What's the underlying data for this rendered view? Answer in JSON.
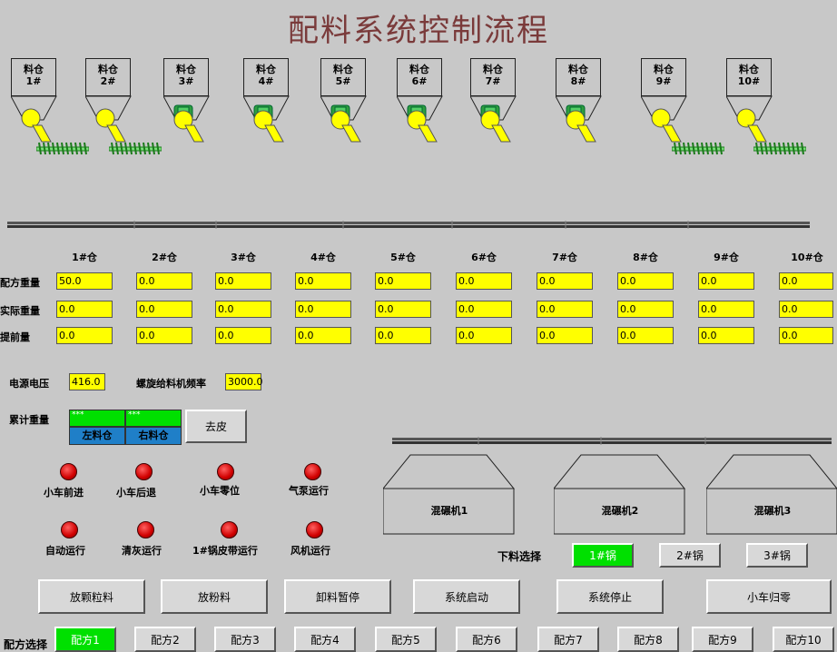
{
  "title": "配料系统控制流程",
  "hoppers": [
    {
      "label": "料仓",
      "num": "1#",
      "running": false,
      "screw": true
    },
    {
      "label": "料仓",
      "num": "2#",
      "running": false,
      "screw": true
    },
    {
      "label": "料仓",
      "num": "3#",
      "running": true,
      "screw": false
    },
    {
      "label": "料仓",
      "num": "4#",
      "running": true,
      "screw": false
    },
    {
      "label": "料仓",
      "num": "5#",
      "running": true,
      "screw": false
    },
    {
      "label": "料仓",
      "num": "6#",
      "running": true,
      "screw": false
    },
    {
      "label": "料仓",
      "num": "7#",
      "running": true,
      "screw": false
    },
    {
      "label": "料仓",
      "num": "8#",
      "running": true,
      "screw": false
    },
    {
      "label": "料仓",
      "num": "9#",
      "running": false,
      "screw": true
    },
    {
      "label": "料仓",
      "num": "10#",
      "running": false,
      "screw": true
    }
  ],
  "table": {
    "columns": [
      "1#仓",
      "2#仓",
      "3#仓",
      "4#仓",
      "5#仓",
      "6#仓",
      "7#仓",
      "8#仓",
      "9#仓",
      "10#仓"
    ],
    "rows": [
      {
        "label": "配方重量",
        "values": [
          "50.0",
          "0.0",
          "0.0",
          "0.0",
          "0.0",
          "0.0",
          "0.0",
          "0.0",
          "0.0",
          "0.0"
        ]
      },
      {
        "label": "实际重量",
        "values": [
          "0.0",
          "0.0",
          "0.0",
          "0.0",
          "0.0",
          "0.0",
          "0.0",
          "0.0",
          "0.0",
          "0.0"
        ]
      },
      {
        "label": "提前量",
        "values": [
          "0.0",
          "0.0",
          "0.0",
          "0.0",
          "0.0",
          "0.0",
          "0.0",
          "0.0",
          "0.0",
          "0.0"
        ]
      }
    ]
  },
  "power": {
    "label": "电源电压",
    "value": "416.0"
  },
  "freq": {
    "label": "螺旋给料机频率",
    "value": "3000.0"
  },
  "total": {
    "label": "累计重量",
    "left_value": "***",
    "right_value": "***",
    "left_label": "左料仓",
    "right_label": "右料仓",
    "tare_label": "去皮"
  },
  "indicators": [
    "小车前进",
    "小车后退",
    "小车零位",
    "气泵运行",
    "自动运行",
    "清灰运行",
    "1#锅皮带运行",
    "风机运行"
  ],
  "mills": [
    "混碾机1",
    "混碾机2",
    "混碾机3"
  ],
  "discharge": {
    "label": "下料选择",
    "options": [
      "1#锅",
      "2#锅",
      "3#锅"
    ],
    "selected": 0
  },
  "actions": [
    "放颗粒料",
    "放粉料",
    "卸料暂停",
    "系统启动",
    "系统停止",
    "小车归零"
  ],
  "recipe": {
    "label": "配方选择",
    "options": [
      "配方1",
      "配方2",
      "配方3",
      "配方4",
      "配方5",
      "配方6",
      "配方7",
      "配方8",
      "配方9",
      "配方10"
    ],
    "selected": 0
  },
  "colors": {
    "yellow": "#ffff00",
    "green": "#00e000",
    "blue": "#1f7fc8",
    "led": "#e00000",
    "title": "#7a3a3a"
  }
}
